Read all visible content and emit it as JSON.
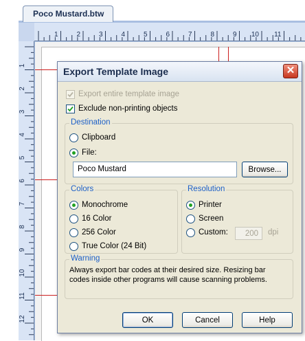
{
  "document_tab": {
    "title": "Poco Mustard.btw"
  },
  "ruler": {
    "horizontal_labels": [
      "1",
      "2",
      "3",
      "4",
      "5",
      "6",
      "7",
      "8",
      "9",
      "10",
      "11"
    ],
    "vertical_labels": [
      "1",
      "2",
      "3",
      "4",
      "5",
      "6",
      "7",
      "8",
      "9",
      "10",
      "11",
      "12"
    ]
  },
  "dialog": {
    "title": "Export Template Image",
    "close_symbol": "✕",
    "export_entire": {
      "label": "Export entire template image",
      "checked": true,
      "disabled": true
    },
    "exclude_nonprinting": {
      "label": "Exclude non-printing objects",
      "checked": true
    },
    "destination": {
      "legend": "Destination",
      "clipboard_label": "Clipboard",
      "file_label": "File:",
      "selected": "file",
      "file_value": "Poco Mustard",
      "browse_label": "Browse..."
    },
    "colors": {
      "legend": "Colors",
      "options": [
        "Monochrome",
        "16 Color",
        "256 Color",
        "True Color (24 Bit)"
      ],
      "selected": "Monochrome"
    },
    "resolution": {
      "legend": "Resolution",
      "printer_label": "Printer",
      "screen_label": "Screen",
      "custom_label": "Custom:",
      "selected": "Printer",
      "custom_value": "200",
      "unit": "dpi"
    },
    "warning": {
      "legend": "Warning",
      "line1": "Always export bar codes at their desired size.  Resizing bar",
      "line2": "codes inside other programs will cause scanning problems."
    },
    "buttons": {
      "ok": "OK",
      "cancel": "Cancel",
      "help": "Help"
    }
  },
  "colors": {
    "accent": "#1c5fc7",
    "guide": "#cc1f1f",
    "radio_dot": "#21a121",
    "close": "#c7371f"
  }
}
